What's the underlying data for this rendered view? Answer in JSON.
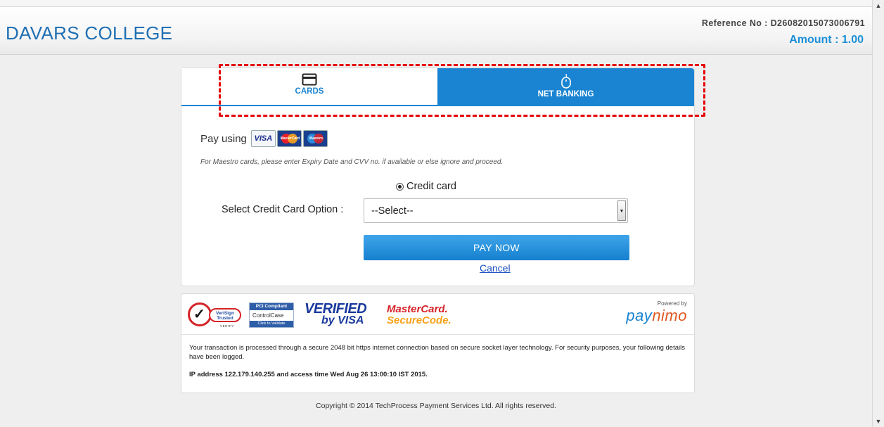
{
  "header": {
    "brand": "DAVARS COLLEGE",
    "reference": "Reference No : D26082015073006791",
    "amount": "Amount : 1.00"
  },
  "tabs": [
    {
      "label": "CARDS",
      "icon": "credit-card-icon",
      "active": true
    },
    {
      "label": "NET BANKING",
      "icon": "mouse-icon",
      "active": false
    }
  ],
  "payment": {
    "pay_using_label": "Pay using",
    "card_logos": [
      "VISA",
      "MasterCard",
      "Maestro"
    ],
    "maestro_note": "For Maestro cards, please enter Expiry Date and CVV no. if available or else ignore and proceed.",
    "radio_label": "Credit card",
    "select_label": "Select Credit Card Option :",
    "select_value": "--Select--",
    "pay_now": "PAY NOW",
    "cancel": "Cancel"
  },
  "trust": {
    "verisign_line1": "VeriSign",
    "verisign_line2": "Trusted",
    "verisign_sub": "VERIFY",
    "pci_top": "PCI Compliant",
    "pci_mid": "ControlCase",
    "pci_bot": "Click to Validate",
    "vbv_line1": "VERIFIED",
    "vbv_line2": "by VISA",
    "mc_line1": "MasterCard.",
    "mc_line2": "SecureCode.",
    "powered_by": "Powered by",
    "paynimo_a": "pay",
    "paynimo_b": "nimo",
    "secure_text": "Your transaction is processed through a secure 2048 bit https internet connection based on secure socket layer technology. For security purposes, your following details have been logged.",
    "ip_text": "IP address 122.179.140.255 and access time Wed Aug 26 13:00:10 IST 2015."
  },
  "footer": {
    "copyright": "Copyright © 2014 TechProcess Payment Services Ltd. All rights reserved."
  },
  "colors": {
    "accent": "#1a84d2",
    "highlight": "#e50000",
    "brand": "#1f6fb3"
  }
}
